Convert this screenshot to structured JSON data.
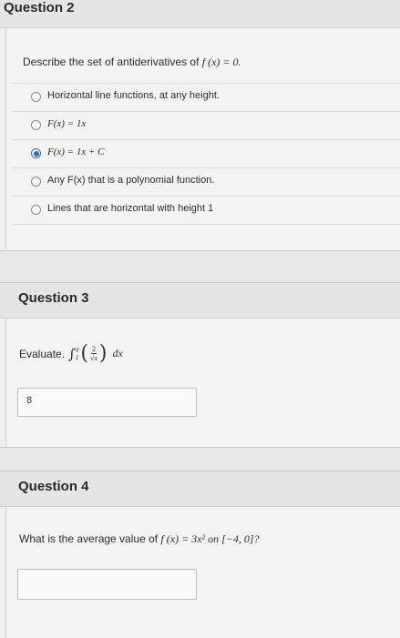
{
  "question2": {
    "title": "Question 2",
    "prompt_text": "Describe the set of antiderivatives of ",
    "prompt_math": "f (x) = 0.",
    "options": [
      {
        "label": "Horizontal line functions, at any height.",
        "checked": false
      },
      {
        "label": "F(x) = 1x",
        "checked": false
      },
      {
        "label": "F(x) = 1x + C",
        "checked": true
      },
      {
        "label": "Any F(x) that is a polynomial function.",
        "checked": false
      },
      {
        "label": "Lines that are horizontal with height 1",
        "checked": false
      }
    ]
  },
  "question3": {
    "title": "Question 3",
    "evaluate_label": "Evaluate.",
    "integral_lower": "1",
    "integral_upper": "9",
    "frac_num": "2",
    "frac_den": "√x",
    "differential": "dx",
    "answer_value": "8"
  },
  "question4": {
    "title": "Question 4",
    "prompt_text": "What is the average value of ",
    "prompt_math": "f (x) = 3x² on [−4, 0]?",
    "answer_value": ""
  },
  "colors": {
    "accent": "#2f6fb8",
    "background": "#e9e8e4",
    "panel": "#f2f1ed"
  }
}
